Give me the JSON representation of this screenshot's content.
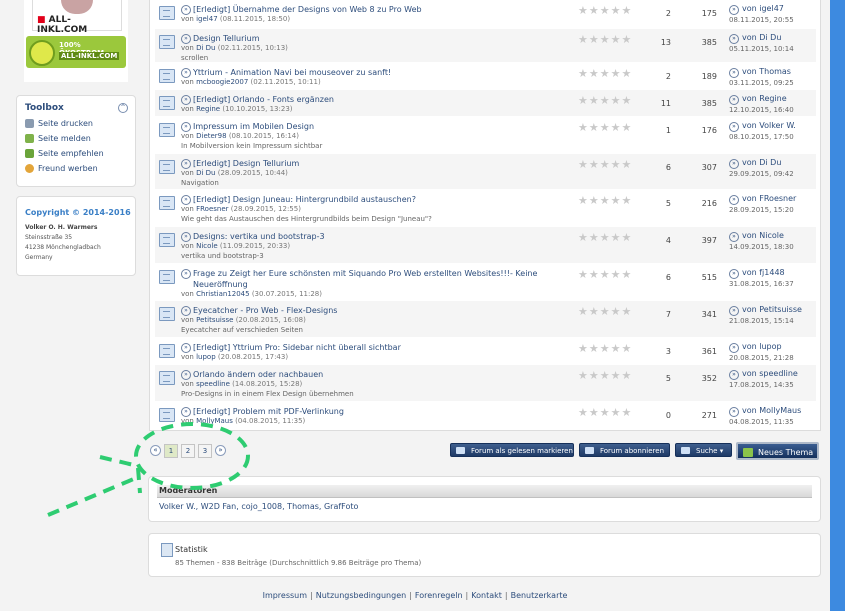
{
  "sidebar": {
    "ads": {
      "allinkl": "ALL-INKL.COM",
      "oeko_line1": "100% ÖKOSTROM",
      "oeko_line2": "ALL-INKL.COM"
    },
    "toolbox": {
      "title": "Toolbox",
      "items": [
        {
          "label": "Seite drucken",
          "icon": "printer-icon"
        },
        {
          "label": "Seite melden",
          "icon": "report-icon"
        },
        {
          "label": "Seite empfehlen",
          "icon": "recommend-icon"
        },
        {
          "label": "Freund werben",
          "icon": "friend-icon"
        }
      ]
    },
    "copyright": {
      "title": "Copyright © 2014-2016",
      "name": "Volker O. H. Warmers",
      "street": "Steinsstraße 35",
      "city": "41238 Mönchengladbach",
      "country": "Germany"
    }
  },
  "topics": [
    {
      "title": "[Erledigt] Übernahme der Designs von Web 8 zu Pro Web",
      "author": "igel47",
      "date": "(08.11.2015, 18:50)",
      "note": "",
      "replies": "2",
      "views": "175",
      "last_user": "von igel47",
      "last_date": "08.11.2015, 20:55"
    },
    {
      "title": "Design Tellurium",
      "author": "Di Du",
      "date": "(02.11.2015, 10:13)",
      "note": "scrollen",
      "replies": "13",
      "views": "385",
      "last_user": "von Di Du",
      "last_date": "05.11.2015, 10:14"
    },
    {
      "title": "Yttrium - Animation Navi bei mouseover zu sanft!",
      "author": "mcboogie2007",
      "date": "(02.11.2015, 10:11)",
      "note": "",
      "replies": "2",
      "views": "189",
      "last_user": "von Thomas",
      "last_date": "03.11.2015, 09:25"
    },
    {
      "title": "[Erledigt] Orlando - Fonts ergänzen",
      "author": "Regine",
      "date": "(10.10.2015, 13:23)",
      "note": "",
      "replies": "11",
      "views": "385",
      "last_user": "von Regine",
      "last_date": "12.10.2015, 16:40"
    },
    {
      "title": "Impressum im Mobilen Design",
      "author": "Dieter98",
      "date": "(08.10.2015, 16:14)",
      "note": "In Mobilversion kein Impressum sichtbar",
      "replies": "1",
      "views": "176",
      "last_user": "von Volker W.",
      "last_date": "08.10.2015, 17:50"
    },
    {
      "title": "[Erledigt] Design Tellurium",
      "author": "Di Du",
      "date": "(28.09.2015, 10:44)",
      "note": "Navigation",
      "replies": "6",
      "views": "307",
      "last_user": "von Di Du",
      "last_date": "29.09.2015, 09:42"
    },
    {
      "title": "[Erledigt] Design Juneau: Hintergrundbild austauschen?",
      "author": "FRoesner",
      "date": "(28.09.2015, 12:55)",
      "note": "Wie geht das Austauschen des Hintergrundbilds beim Design \"Juneau\"?",
      "replies": "5",
      "views": "216",
      "last_user": "von FRoesner",
      "last_date": "28.09.2015, 15:20"
    },
    {
      "title": "Designs: vertika und bootstrap-3",
      "author": "Nicole",
      "date": "(11.09.2015, 20:33)",
      "note": "vertika und bootstrap-3",
      "replies": "4",
      "views": "397",
      "last_user": "von Nicole",
      "last_date": "14.09.2015, 18:30"
    },
    {
      "title": "Frage zu Zeigt her Eure schönsten mit Siquando Pro Web erstellten Websites!!!- Keine Neueröffnung",
      "author": "Christian12045",
      "date": "(30.07.2015, 11:28)",
      "note": "",
      "replies": "6",
      "views": "515",
      "last_user": "von fj1448",
      "last_date": "31.08.2015, 16:37"
    },
    {
      "title": "Eyecatcher - Pro Web - Flex-Designs",
      "author": "Petitsuisse",
      "date": "(20.08.2015, 16:08)",
      "note": "Eyecatcher auf verschieden Seiten",
      "replies": "7",
      "views": "341",
      "last_user": "von Petitsuisse",
      "last_date": "21.08.2015, 15:14"
    },
    {
      "title": "[Erledigt] Yttrium Pro: Sidebar nicht überall sichtbar",
      "author": "lupop",
      "date": "(20.08.2015, 17:43)",
      "note": "",
      "replies": "3",
      "views": "361",
      "last_user": "von lupop",
      "last_date": "20.08.2015, 21:28"
    },
    {
      "title": "Orlando ändern oder nachbauen",
      "author": "speedline",
      "date": "(14.08.2015, 15:28)",
      "note": "Pro-Designs in in einem Flex Design übernehmen",
      "replies": "5",
      "views": "352",
      "last_user": "von speedline",
      "last_date": "17.08.2015, 14:35"
    },
    {
      "title": "[Erledigt] Problem mit PDF-Verlinkung",
      "author": "MollyMaus",
      "date": "(04.08.2015, 11:35)",
      "note": "",
      "replies": "0",
      "views": "271",
      "last_user": "von MollyMaus",
      "last_date": "04.08.2015, 11:35"
    }
  ],
  "by_prefix": "von",
  "stars": "★★★★★",
  "arrow_glyph": "»",
  "pagination": {
    "prev": "«",
    "pages": [
      "1",
      "2",
      "3"
    ],
    "next": "»",
    "current": "1"
  },
  "buttons": {
    "mark_read": "Forum als gelesen markieren",
    "subscribe": "Forum abonnieren",
    "search": "Suche ▾",
    "new_topic": "Neues Thema"
  },
  "moderators": {
    "title": "Moderatoren",
    "names": "Volker W., W2D Fan, cojo_1008, Thomas, GrafFoto"
  },
  "stats": {
    "title": "Statistik",
    "detail": "85 Themen - 838 Beiträge (Durchschnittlich 9.86 Beiträge pro Thema)"
  },
  "footer": {
    "links": [
      "Impressum",
      "Nutzungsbedingungen",
      "Forenregeln",
      "Kontakt",
      "Benutzerkarte"
    ],
    "separator": "|"
  },
  "colors": {
    "annotation": "#2ecc71",
    "accent": "#2d4d7c",
    "button": "#1f3a66"
  }
}
